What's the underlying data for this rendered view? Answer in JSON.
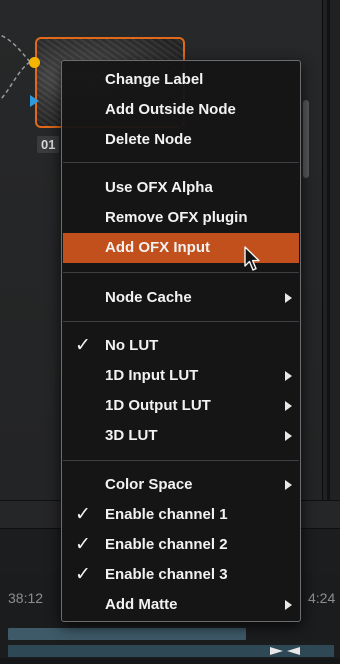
{
  "node": {
    "label": "01"
  },
  "timeline": {
    "timecode_left": "38:12",
    "timecode_right": "4:24"
  },
  "menu": {
    "items": [
      {
        "label": "Change Label",
        "checked": false,
        "submenu": false
      },
      {
        "label": "Add Outside Node",
        "checked": false,
        "submenu": false
      },
      {
        "label": "Delete Node",
        "checked": false,
        "submenu": false
      },
      {
        "label": "Use OFX Alpha",
        "checked": false,
        "submenu": false
      },
      {
        "label": "Remove OFX plugin",
        "checked": false,
        "submenu": false
      },
      {
        "label": "Add OFX Input",
        "checked": false,
        "submenu": false,
        "highlighted": true
      },
      {
        "label": "Node Cache",
        "checked": false,
        "submenu": true
      },
      {
        "label": "No LUT",
        "checked": true,
        "submenu": false
      },
      {
        "label": "1D Input LUT",
        "checked": false,
        "submenu": true
      },
      {
        "label": "1D Output LUT",
        "checked": false,
        "submenu": true
      },
      {
        "label": "3D LUT",
        "checked": false,
        "submenu": true
      },
      {
        "label": "Color Space",
        "checked": false,
        "submenu": true
      },
      {
        "label": "Enable channel 1",
        "checked": true,
        "submenu": false
      },
      {
        "label": "Enable channel 2",
        "checked": true,
        "submenu": false
      },
      {
        "label": "Enable channel 3",
        "checked": true,
        "submenu": false
      },
      {
        "label": "Add Matte",
        "checked": false,
        "submenu": true
      }
    ],
    "check_glyph": "✓"
  },
  "colors": {
    "highlight": "#c2501c",
    "node_border": "#e06a1a",
    "input_dot": "#f4b400",
    "input_triangle": "#2e9be0",
    "track": "#3e5968"
  },
  "icons": {
    "cursor": "mouse-pointer-icon",
    "submenu": "chevron-right-icon",
    "check": "checkmark-icon"
  }
}
